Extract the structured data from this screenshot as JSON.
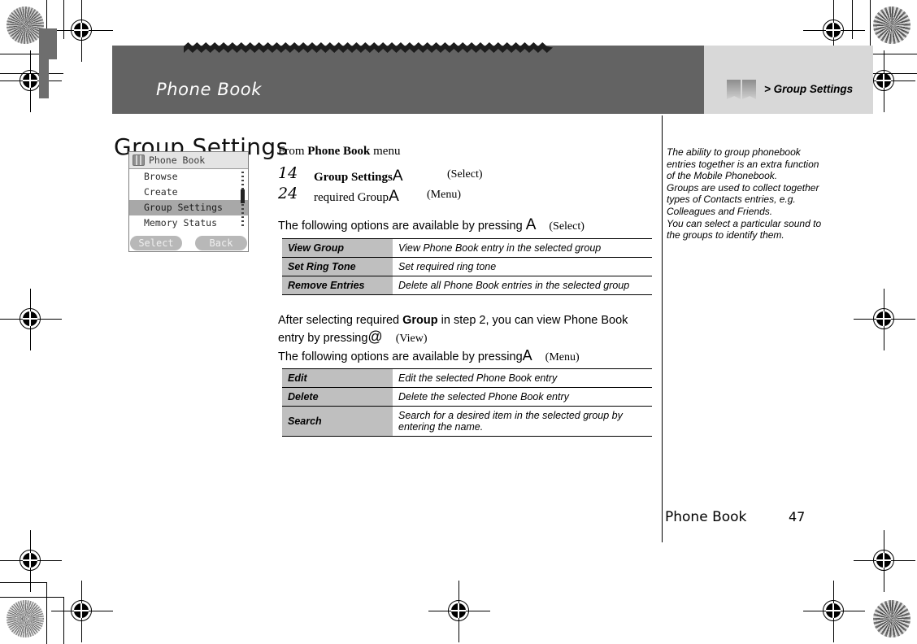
{
  "header": {
    "running_title": "Phone Book",
    "tab_label": "> Group Settings",
    "tab_icon": "open-book-icon"
  },
  "page_title": "Group Settings",
  "phone_mock": {
    "title_bar": {
      "icon": "phone-book-icon",
      "label": "Phone Book"
    },
    "menu_items": [
      {
        "label": "Browse",
        "selected": false
      },
      {
        "label": "Create",
        "selected": false
      },
      {
        "label": "Group Settings",
        "selected": true
      },
      {
        "label": "Memory Status",
        "selected": false
      }
    ],
    "softkeys": {
      "left": "Select",
      "right": "Back"
    }
  },
  "intro": {
    "from_prefix": "From ",
    "from_bold": "Phone Book",
    "from_suffix": " menu"
  },
  "steps": [
    {
      "number": "1",
      "marker": "4",
      "text_bold": "Group Settings",
      "text_plain": "",
      "key_glyph": "A",
      "paren": "(Select)"
    },
    {
      "number": "2",
      "marker": "4",
      "text_bold": "",
      "text_plain": "required Group",
      "key_glyph": "A",
      "paren": "(Menu)"
    }
  ],
  "lead_line": {
    "text": "The following options are available by pressing ",
    "key_glyph": "A",
    "paren": "(Select)"
  },
  "table_select": {
    "rows": [
      {
        "option": "View Group",
        "description": "View Phone Book entry in the selected group"
      },
      {
        "option": "Set Ring Tone",
        "description": "Set required ring tone"
      },
      {
        "option": "Remove Entries",
        "description": "Delete all Phone Book entries in the selected group"
      }
    ]
  },
  "mid_paragraph": {
    "line1_a": "After selecting required ",
    "line1_bold": "Group",
    "line1_b": " in step 2, you can view Phone Book",
    "line2_a": "entry by pressing",
    "line2_key": "@",
    "line2_paren": "(View)",
    "line3_a": "The following options are available by pressing",
    "line3_key": "A",
    "line3_paren": "(Menu)"
  },
  "table_menu": {
    "rows": [
      {
        "option": "Edit",
        "description": "Edit the selected Phone Book entry"
      },
      {
        "option": "Delete",
        "description": "Delete the selected Phone Book entry"
      },
      {
        "option": "Search",
        "description": "Search for a desired item in the selected group by entering the name."
      }
    ]
  },
  "side_note": {
    "paragraphs": [
      "The ability to group phonebook entries together is an extra function of the Mobile Phonebook.",
      "Groups are used to collect together types of Contacts entries, e.g. Colleagues and Friends.",
      "You can select a particular sound to the groups to identify them."
    ]
  },
  "footer": {
    "section": "Phone Book",
    "page_number": "47"
  },
  "colors": {
    "header_bar": "#636363",
    "tab_block": "#d8d8d8",
    "table_key_cell": "#bfbfbf",
    "phone_selected_row": "#a8a8a8",
    "softkey": "#b8b8b8"
  }
}
